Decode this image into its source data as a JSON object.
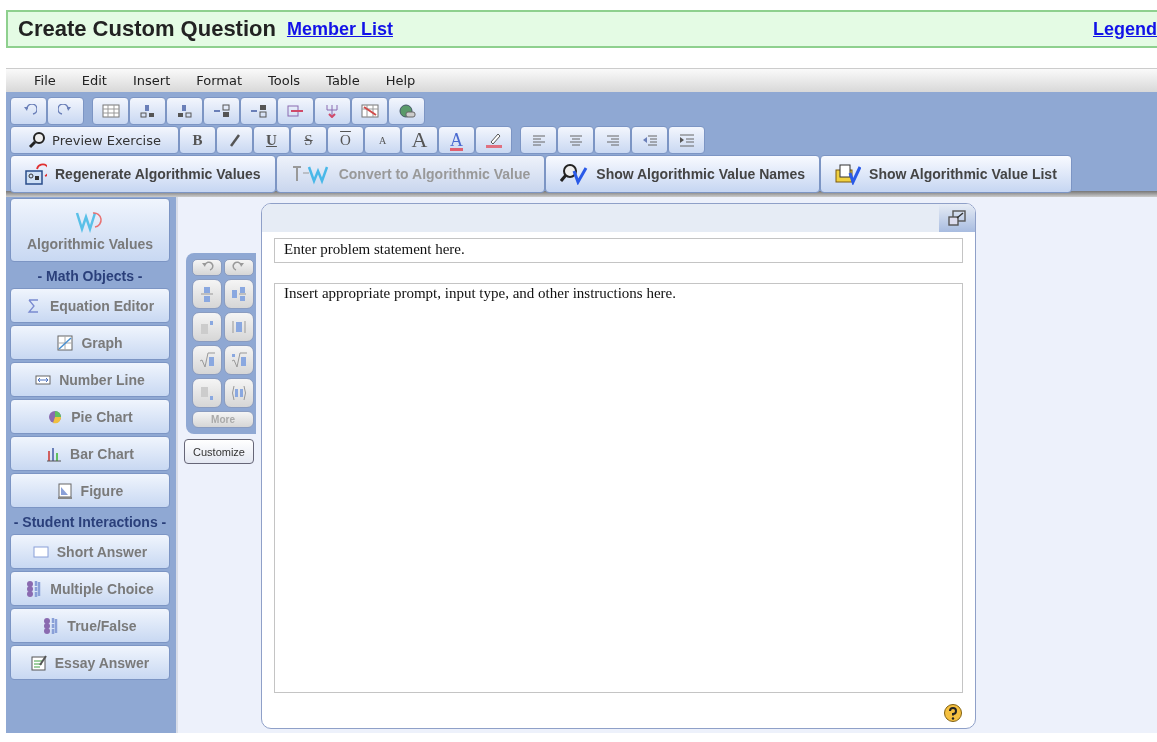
{
  "header": {
    "title": "Create Custom Question",
    "link": "Member List",
    "legend": "Legend"
  },
  "menu": [
    "File",
    "Edit",
    "Insert",
    "Format",
    "Tools",
    "Table",
    "Help"
  ],
  "toolbar": {
    "preview": "Preview Exercise",
    "format_buttons": [
      {
        "kind": "bold",
        "label": "B"
      },
      {
        "kind": "italic"
      },
      {
        "kind": "underline",
        "label": "U"
      },
      {
        "kind": "strike",
        "label": "S"
      },
      {
        "kind": "overline",
        "label": "O"
      },
      {
        "kind": "shrink",
        "label": "A"
      },
      {
        "kind": "grow",
        "label": "A"
      },
      {
        "kind": "color",
        "label": "A"
      },
      {
        "kind": "highlight"
      }
    ],
    "actions": [
      {
        "label": "Regenerate Algorithmic Values",
        "disabled": false
      },
      {
        "label": "Convert to Algorithmic Value",
        "disabled": true
      },
      {
        "label": "Show Algorithmic Value Names",
        "disabled": false
      },
      {
        "label": "Show Algorithmic Value List",
        "disabled": false
      }
    ]
  },
  "sidebar": {
    "top": "Algorithmic Values",
    "sections": [
      {
        "heading": "- Math Objects -",
        "items": [
          "Equation Editor",
          "Graph",
          "Number Line",
          "Pie Chart",
          "Bar Chart",
          "Figure"
        ]
      },
      {
        "heading": "- Student Interactions -",
        "items": [
          "Short Answer",
          "Multiple Choice",
          "True/False",
          "Essay Answer"
        ]
      }
    ]
  },
  "palette": {
    "more": "More",
    "customize": "Customize"
  },
  "editor": {
    "statement": "Enter problem statement here.",
    "prompt": "Insert appropriate prompt, input type, and other instructions here."
  }
}
